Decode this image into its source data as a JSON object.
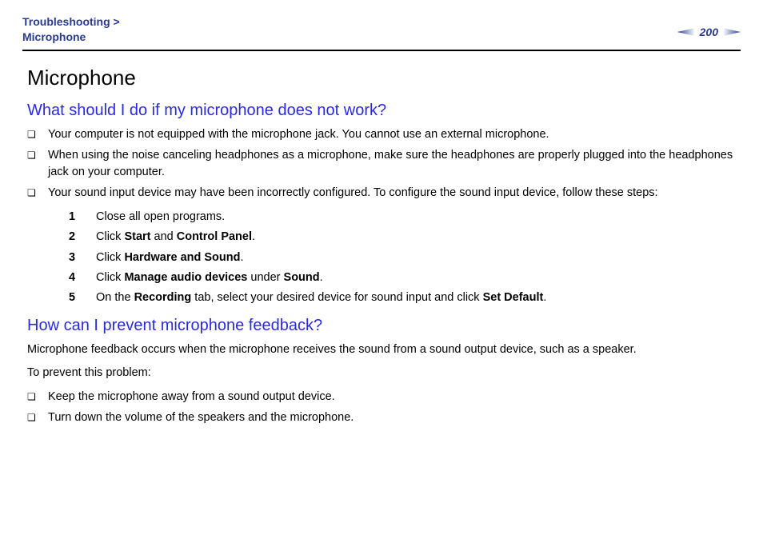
{
  "header": {
    "breadcrumb_top": "Troubleshooting >",
    "breadcrumb_sub": "Microphone",
    "page_number": "200"
  },
  "title": "Microphone",
  "section1": {
    "heading": "What should I do if my microphone does not work?",
    "bullets": {
      "b1": "Your computer is not equipped with the microphone jack. You cannot use an external microphone.",
      "b2": "When using the noise canceling headphones as a microphone, make sure the headphones are properly plugged into the headphones jack on your computer.",
      "b3": "Your sound input device may have been incorrectly configured. To configure the sound input device, follow these steps:"
    },
    "steps": {
      "s1": {
        "n": "1",
        "pre": "Close all open programs."
      },
      "s2": {
        "n": "2",
        "pre": "Click ",
        "b1": "Start",
        "mid": " and ",
        "b2": "Control Panel",
        "post": "."
      },
      "s3": {
        "n": "3",
        "pre": "Click ",
        "b1": "Hardware and Sound",
        "post": "."
      },
      "s4": {
        "n": "4",
        "pre": "Click ",
        "b1": "Manage audio devices",
        "mid": " under ",
        "b2": "Sound",
        "post": "."
      },
      "s5": {
        "n": "5",
        "pre": "On the ",
        "b1": "Recording",
        "mid": " tab, select your desired device for sound input and click ",
        "b2": "Set Default",
        "post": "."
      }
    }
  },
  "section2": {
    "heading": "How can I prevent microphone feedback?",
    "p1": "Microphone feedback occurs when the microphone receives the sound from a sound output device, such as a speaker.",
    "p2": "To prevent this problem:",
    "bullets": {
      "b1": "Keep the microphone away from a sound output device.",
      "b2": "Turn down the volume of the speakers and the microphone."
    }
  }
}
